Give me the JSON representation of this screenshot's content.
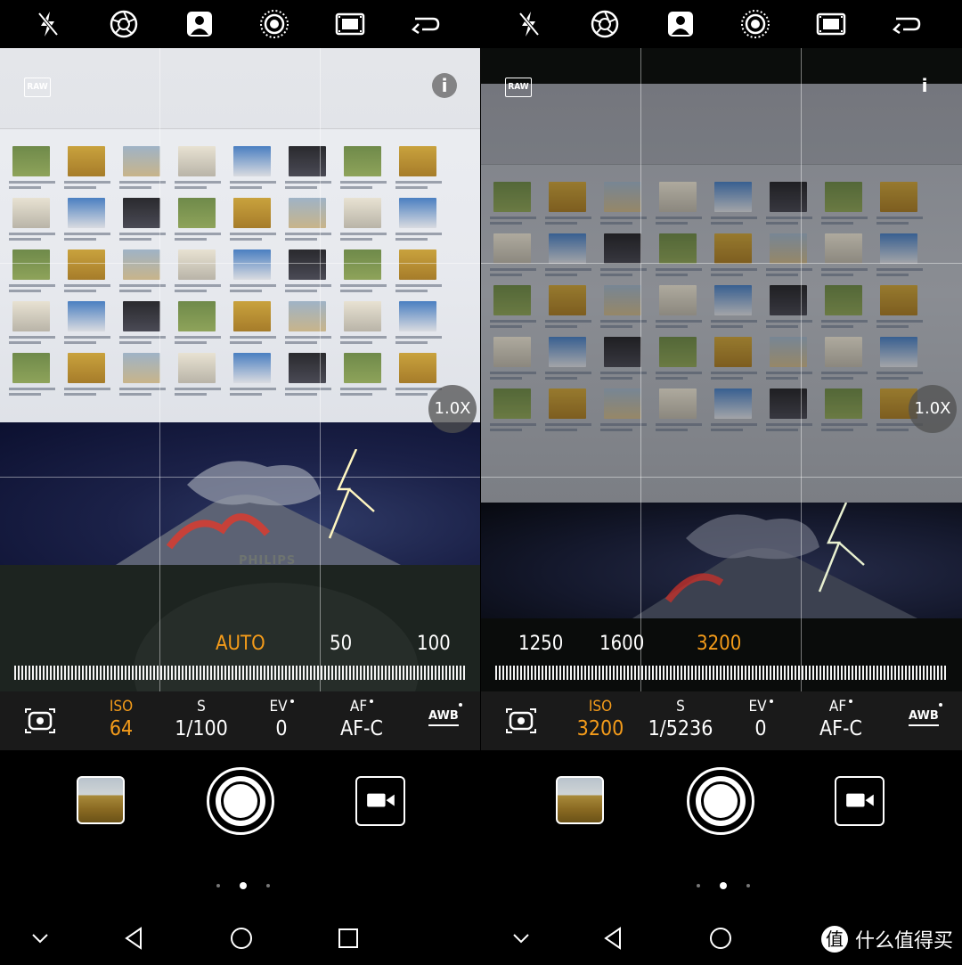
{
  "left": {
    "raw_label": "RAW",
    "info_label": "i",
    "zoom_label": "1.0X",
    "monitor_brand": "PHILIPS",
    "scale": [
      {
        "text": "AUTO",
        "selected": true
      },
      {
        "text": "50",
        "selected": false
      },
      {
        "text": "100",
        "selected": false
      }
    ],
    "settings": {
      "iso_label": "ISO",
      "iso_value": "64",
      "s_label": "S",
      "s_value": "1/100",
      "ev_label": "EV",
      "ev_value": "0",
      "af_label": "AF",
      "af_value": "AF-C",
      "awb_label": "AWB"
    }
  },
  "right": {
    "raw_label": "RAW",
    "info_label": "i",
    "zoom_label": "1.0X",
    "scale": [
      {
        "text": "1250",
        "selected": false
      },
      {
        "text": "1600",
        "selected": false
      },
      {
        "text": "3200",
        "selected": true
      }
    ],
    "settings": {
      "iso_label": "ISO",
      "iso_value": "3200",
      "s_label": "S",
      "s_value": "1/5236",
      "ev_label": "EV",
      "ev_value": "0",
      "af_label": "AF",
      "af_value": "AF-C",
      "awb_label": "AWB"
    }
  },
  "top_icons": [
    "flash-off-icon",
    "aperture-icon",
    "portrait-icon",
    "live-photo-icon",
    "film-filter-icon",
    "switch-camera-icon"
  ],
  "watermark": {
    "badge": "值",
    "text": "什么值得买"
  },
  "colors": {
    "accent": "#f59c1a",
    "settings_bg": "#1a1a1a"
  }
}
